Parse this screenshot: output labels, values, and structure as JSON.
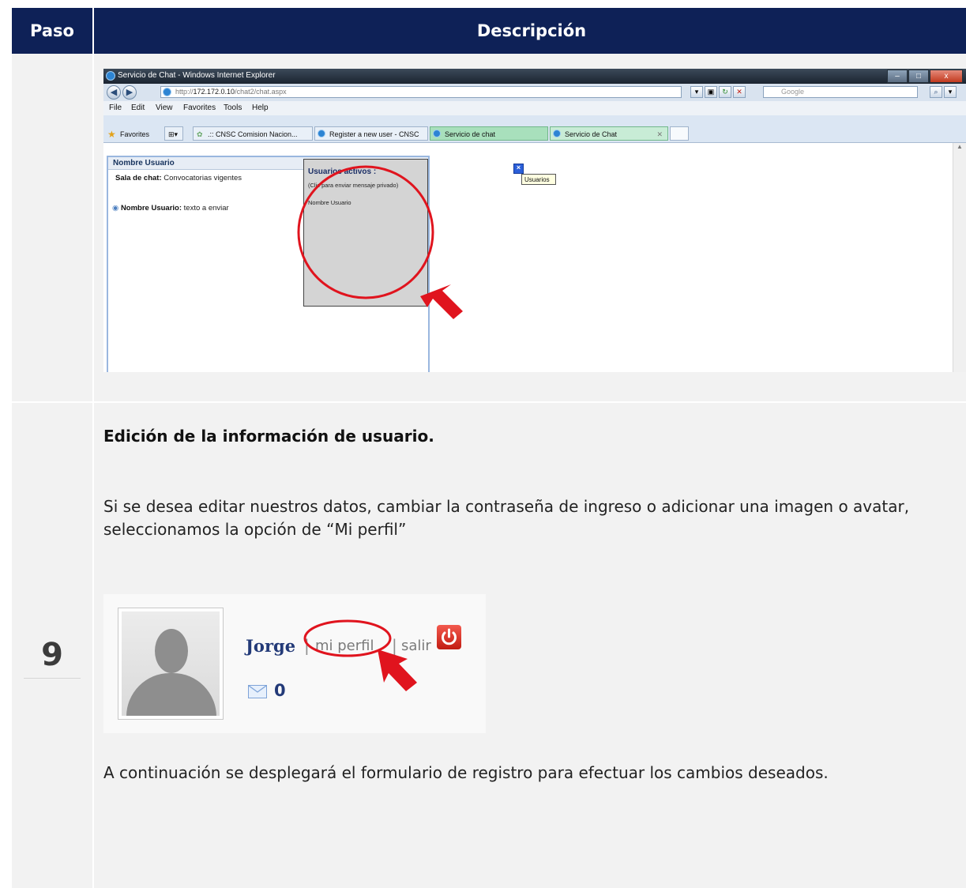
{
  "table": {
    "header_step": "Paso",
    "header_description": "Descripción",
    "step_number": "9"
  },
  "browser": {
    "window_title": "Servicio de Chat - Windows Internet Explorer",
    "url_prefix": "http://",
    "url_host": "172.172.0.10",
    "url_path": "/chat2/chat.aspx",
    "search_placeholder": "Google",
    "menu": [
      "File",
      "Edit",
      "View",
      "Favorites",
      "Tools",
      "Help"
    ],
    "favorites_label": "Favorites",
    "tabs": [
      ".:: CNSC Comision Nacion...",
      "Register a new user - CNSC",
      "Servicio de chat",
      "Servicio de Chat"
    ],
    "chat_header": "Nombre Usuario",
    "chat_room_label": "Sala de chat:",
    "chat_room_value": "Convocatorias vigentes",
    "chat_msg_user": "Nombre Usuario:",
    "chat_msg_text": "texto a enviar",
    "popup_title": "Usuarios activos :",
    "popup_hint": "(Clic para enviar mensaje privado)",
    "popup_user": "Nombre Usuario",
    "tooltip": "Usuarios"
  },
  "content": {
    "section_title": "Edición de la información de usuario.",
    "paragraph_1": "Si se desea editar nuestros datos, cambiar la contraseña de ingreso o adicionar una imagen o avatar, seleccionamos la opción de “Mi perfil”",
    "paragraph_2": "A continuación se desplegará el formulario de registro para efectuar los cambios deseados."
  },
  "profile": {
    "username": "Jorge",
    "profile_link": "mi perfil",
    "logout_link": "salir",
    "message_count": "0"
  },
  "colors": {
    "header_bg": "#0e2157",
    "highlight_red": "#e0141e"
  }
}
